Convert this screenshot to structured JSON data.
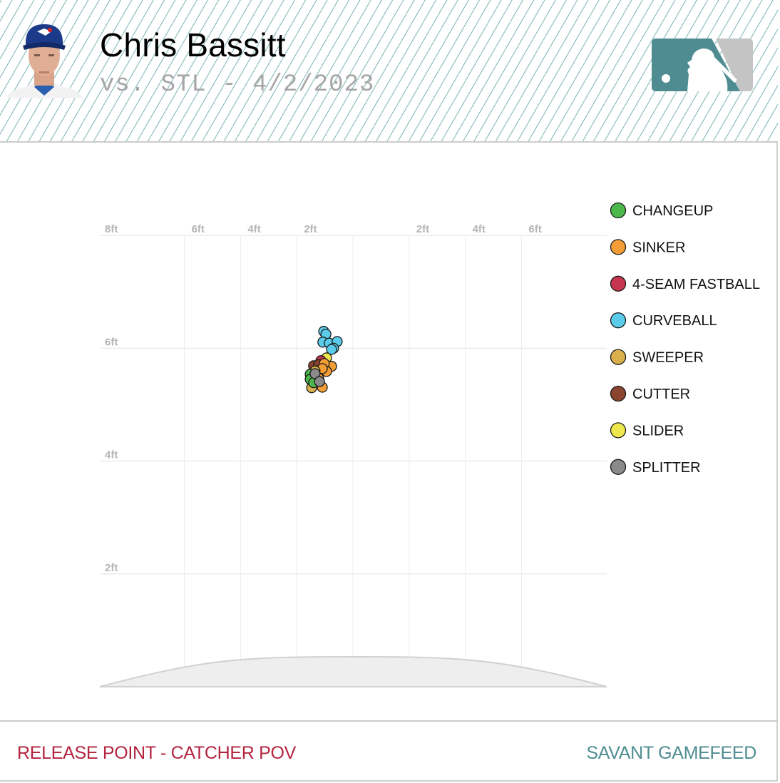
{
  "header": {
    "player_name": "Chris Bassitt",
    "game_info": "vs. STL - 4/2/2023",
    "team_cap_colors": {
      "cap": "#1b3a8a",
      "jersey": "#ffffff"
    },
    "logo": "mlb-logo-icon",
    "logo_colors": {
      "primary": "#4f8c91",
      "secondary": "#c4c4c4"
    }
  },
  "footer": {
    "left_label": "RELEASE POINT - CATCHER POV",
    "right_label": "SAVANT GAMEFEED"
  },
  "chart_data": {
    "type": "scatter",
    "title": "Release Point - Catcher POV",
    "xlabel": "",
    "ylabel": "",
    "x_ticks": [
      {
        "value": -6,
        "label": "6ft"
      },
      {
        "value": -4,
        "label": "4ft"
      },
      {
        "value": -2,
        "label": "2ft"
      },
      {
        "value": 2,
        "label": "2ft"
      },
      {
        "value": 4,
        "label": "4ft"
      },
      {
        "value": 6,
        "label": "6ft"
      }
    ],
    "x_gridlines": [
      -6,
      -4,
      -2,
      0,
      2,
      4,
      6
    ],
    "y_ticks": [
      {
        "value": 8,
        "label": "8ft"
      },
      {
        "value": 6,
        "label": "6ft"
      },
      {
        "value": 4,
        "label": "4ft"
      },
      {
        "value": 2,
        "label": "2ft"
      }
    ],
    "xlim": [
      -9,
      9
    ],
    "ylim": [
      0,
      8.4
    ],
    "grid": true,
    "legend_position": "right",
    "series": [
      {
        "name": "CHANGEUP",
        "color": "#4cb84c",
        "points": [
          [
            -1.52,
            5.54
          ],
          [
            -1.52,
            5.45
          ],
          [
            -1.4,
            5.39
          ]
        ]
      },
      {
        "name": "SINKER",
        "color": "#f29d35",
        "points": [
          [
            -0.76,
            5.68
          ],
          [
            -1.02,
            5.73
          ],
          [
            -0.94,
            5.59
          ],
          [
            -1.09,
            5.64
          ],
          [
            -1.09,
            5.31
          ],
          [
            -1.22,
            5.47
          ]
        ]
      },
      {
        "name": "4-SEAM FASTBALL",
        "color": "#c7364f",
        "points": [
          [
            -1.14,
            5.78
          ]
        ]
      },
      {
        "name": "CURVEBALL",
        "color": "#5bcbea",
        "points": [
          [
            -1.04,
            6.3
          ],
          [
            -0.96,
            6.25
          ],
          [
            -1.07,
            6.11
          ],
          [
            -0.84,
            6.09
          ],
          [
            -0.56,
            6.12
          ],
          [
            -0.69,
            6.0
          ],
          [
            -0.76,
            5.98
          ]
        ]
      },
      {
        "name": "SWEEPER",
        "color": "#d9b04c",
        "points": [
          [
            -1.47,
            5.3
          ],
          [
            -1.35,
            5.6
          ]
        ]
      },
      {
        "name": "CUTTER",
        "color": "#8b4430",
        "points": [
          [
            -1.4,
            5.69
          ],
          [
            -1.22,
            5.71
          ],
          [
            -1.29,
            5.6
          ]
        ]
      },
      {
        "name": "SLIDER",
        "color": "#ede64c",
        "points": [
          [
            -0.94,
            5.83
          ]
        ]
      },
      {
        "name": "SPLITTER",
        "color": "#8a8a8a",
        "points": [
          [
            -1.35,
            5.55
          ],
          [
            -1.19,
            5.41
          ]
        ]
      }
    ],
    "annotations": [
      "pitcher's mound outline at bottom"
    ]
  }
}
